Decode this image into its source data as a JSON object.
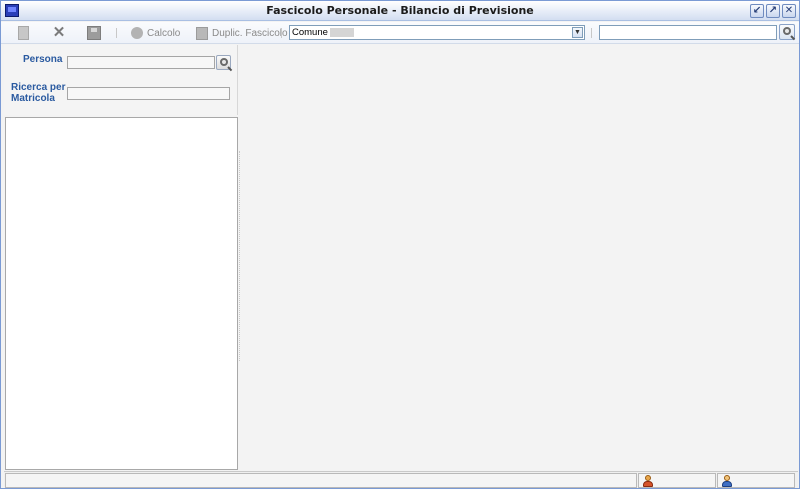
{
  "window": {
    "title": "Fascicolo Personale - Bilancio di Previsione",
    "controls": [
      "minimize-icon",
      "maximize-icon",
      "close-icon"
    ]
  },
  "toolbar": {
    "new_icon": "document-icon",
    "delete_icon": "x-icon",
    "save_icon": "floppy-icon",
    "calcolo_label": "Calcolo",
    "duplic_label": "Duplic. Fascicolo",
    "comune_value": "Comune",
    "search_value": ""
  },
  "left_panel": {
    "persona_label": "Persona",
    "persona_value": "",
    "matricola_label_1": "Ricerca per",
    "matricola_label_2": "Matricola",
    "matricola_value": ""
  },
  "status_bar": {
    "user_icon": "user-icon",
    "users_icon": "users-icon"
  },
  "colors": {
    "title_gradient": "#e4ebf7",
    "label_blue": "#2a5aa0",
    "border": "#7a9ad4"
  }
}
